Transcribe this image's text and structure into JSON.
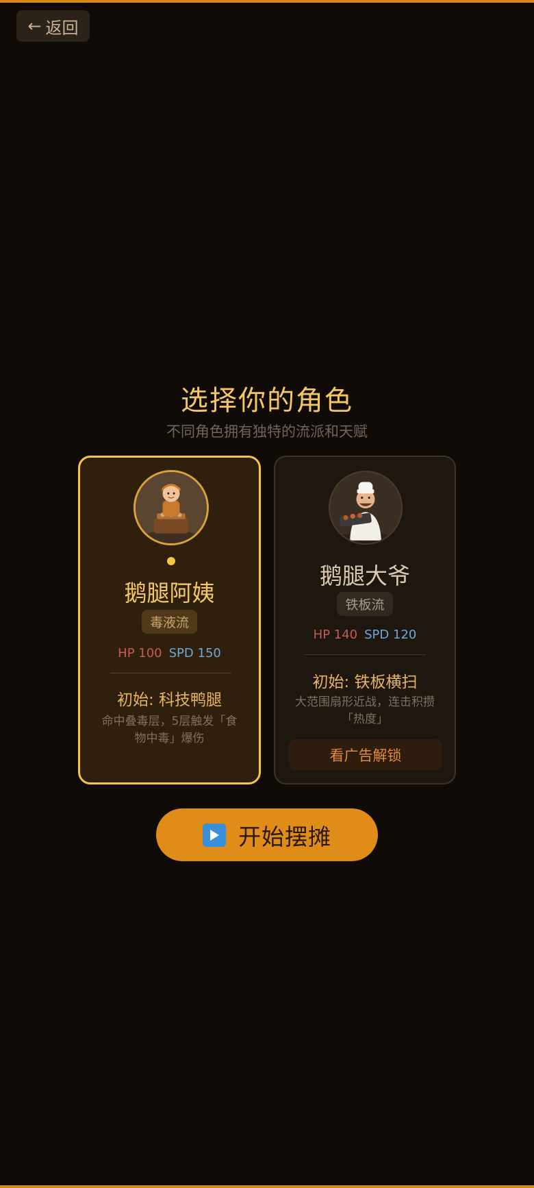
{
  "header": {
    "back_label": "返回"
  },
  "title": "选择你的角色",
  "subtitle": "不同角色拥有独特的流派和天赋",
  "characters": [
    {
      "name": "鹅腿阿姨",
      "tag": "毒液流",
      "hp": "HP 100",
      "spd": "SPD 150",
      "skill": "初始: 科技鸭腿",
      "desc": "命中叠毒层，5层触发「食物中毒」爆伤",
      "selected": true,
      "locked": false
    },
    {
      "name": "鹅腿大爷",
      "tag": "铁板流",
      "hp": "HP 140",
      "spd": "SPD 120",
      "skill": "初始: 铁板横扫",
      "desc": "大范围扇形近战，连击积攒「热度」",
      "selected": false,
      "locked": true,
      "unlock_label": "看广告解锁"
    }
  ],
  "start_button": {
    "icon": "play-icon",
    "label": "开始摆摊"
  },
  "colors": {
    "background": "#100b07",
    "accent": "#e08c18",
    "gold": "#f6c548",
    "hp": "#c85a55",
    "spd": "#6ea8d8"
  }
}
